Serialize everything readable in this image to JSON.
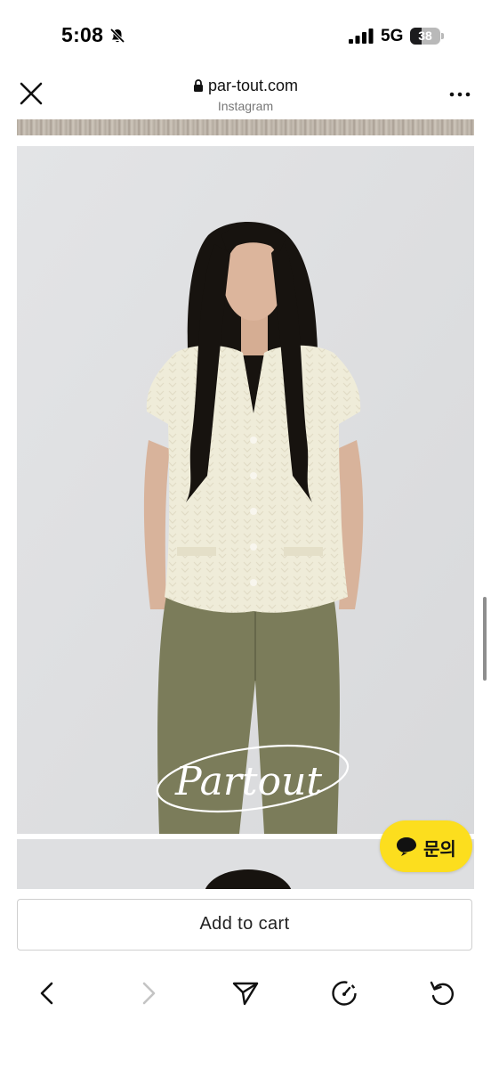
{
  "status_bar": {
    "time": "5:08",
    "network": "5G",
    "battery_level": 38,
    "battery_text": "38",
    "mute_icon": "bell-slash-icon",
    "signal_icon": "signal-bars-icon"
  },
  "browser": {
    "close_icon": "close-icon",
    "lock_icon": "lock-icon",
    "url": "par-tout.com",
    "subtitle": "Instagram",
    "more_icon": "more-horizontal-icon"
  },
  "product": {
    "logo_text": "Partout"
  },
  "chat_button": {
    "icon": "speech-bubble-icon",
    "label": "문의",
    "color": "#fcde1e"
  },
  "cart": {
    "button_label": "Add to cart"
  },
  "toolbar": {
    "items": [
      "back-arrow-icon",
      "forward-arrow-icon",
      "send-icon",
      "speed-gauge-icon",
      "reload-icon"
    ]
  }
}
